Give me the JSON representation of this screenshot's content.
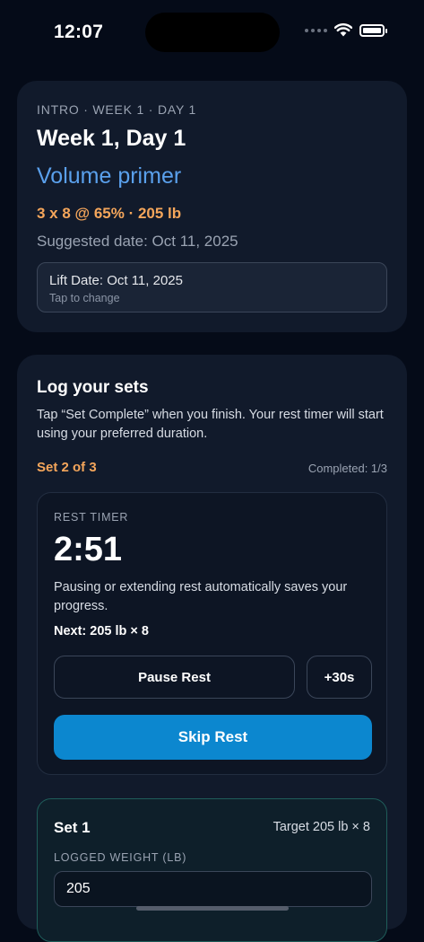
{
  "status_bar": {
    "time": "12:07"
  },
  "workout": {
    "eyebrow": "INTRO · WEEK 1 · DAY 1",
    "title": "Week 1, Day 1",
    "subtitle": "Volume primer",
    "prescription": "3 x 8 @ 65% · 205 lb",
    "suggested_date": "Suggested date: Oct 11, 2025",
    "lift_date_label": "Lift Date: Oct 11, 2025",
    "lift_date_hint": "Tap to change"
  },
  "log": {
    "title": "Log your sets",
    "description": "Tap “Set Complete” when you finish. Your rest timer will start using your preferred duration.",
    "set_progress": "Set 2 of 3",
    "completed": "Completed: 1/3"
  },
  "rest_timer": {
    "eyebrow": "REST TIMER",
    "time": "2:51",
    "note": "Pausing or extending rest automatically saves your progress.",
    "next": "Next: 205 lb × 8",
    "pause_label": "Pause Rest",
    "extend_label": "+30s",
    "skip_label": "Skip Rest"
  },
  "set_entry": {
    "name": "Set 1",
    "target": "Target 205 lb × 8",
    "weight_label": "LOGGED WEIGHT (LB)",
    "weight_value": "205"
  },
  "colors": {
    "background": "#050b18",
    "card": "#111a2b",
    "accent_blue": "#5aa0ec",
    "accent_orange": "#f5a65b",
    "primary_button": "#0c87cf",
    "set_card_border": "#1f5d5a"
  }
}
